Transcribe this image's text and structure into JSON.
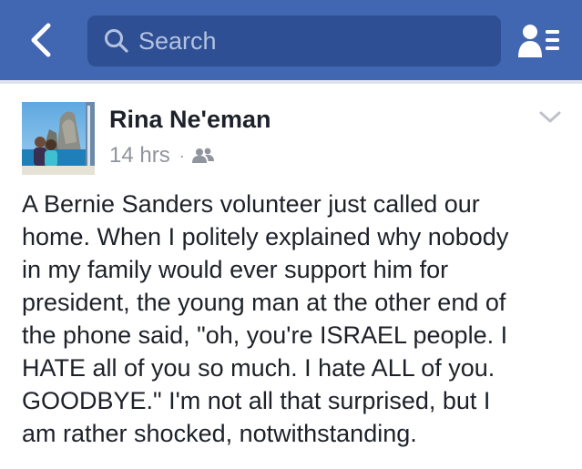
{
  "navbar": {
    "search_placeholder": "Search",
    "back_icon": "chevron-left-icon",
    "requests_icon": "friend-requests-icon",
    "background": "#4267b2"
  },
  "post": {
    "author": "Rina Ne'eman",
    "timestamp": "14 hrs",
    "separator": "·",
    "audience_icon": "friends-icon",
    "options_icon": "chevron-down-icon",
    "body_lines": [
      "A Bernie Sanders volunteer just called our",
      "home. When I politely explained why nobody",
      "in my family would ever support him for",
      "president, the young man at the other end of",
      "the phone said, \"oh, you're ISRAEL people. I",
      "HATE all of you so much. I hate ALL of you.",
      "GOODBYE.\" I'm not all that surprised, but I",
      "am rather shocked, notwithstanding."
    ]
  }
}
